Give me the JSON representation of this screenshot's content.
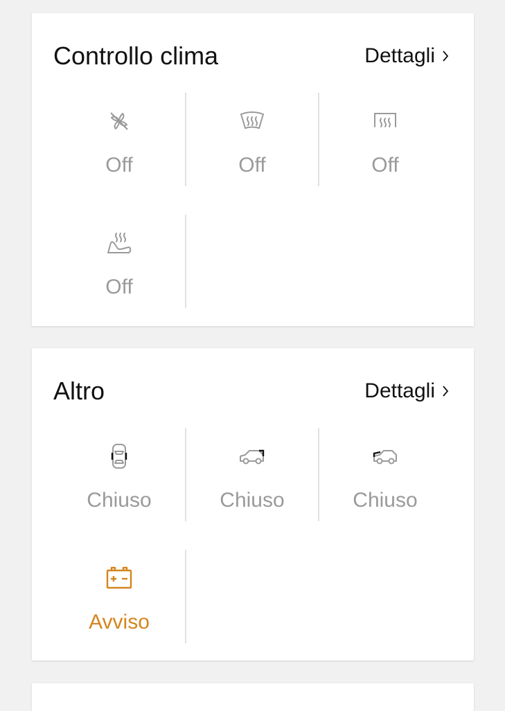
{
  "climate": {
    "title": "Controllo clima",
    "details_label": "Dettagli",
    "tiles": [
      {
        "icon": "fan-off-icon",
        "status": "Off"
      },
      {
        "icon": "windshield-defrost-icon",
        "status": "Off"
      },
      {
        "icon": "rear-window-defrost-icon",
        "status": "Off"
      },
      {
        "icon": "seat-heating-icon",
        "status": "Off"
      }
    ]
  },
  "other": {
    "title": "Altro",
    "details_label": "Dettagli",
    "tiles": [
      {
        "icon": "car-doors-icon",
        "status": "Chiuso"
      },
      {
        "icon": "car-trunk-icon",
        "status": "Chiuso"
      },
      {
        "icon": "car-hood-icon",
        "status": "Chiuso"
      },
      {
        "icon": "battery-icon",
        "status": "Avviso"
      }
    ]
  },
  "colors": {
    "inactive": "#9a9a9a",
    "warning": "#d4851d",
    "text": "#111111"
  }
}
